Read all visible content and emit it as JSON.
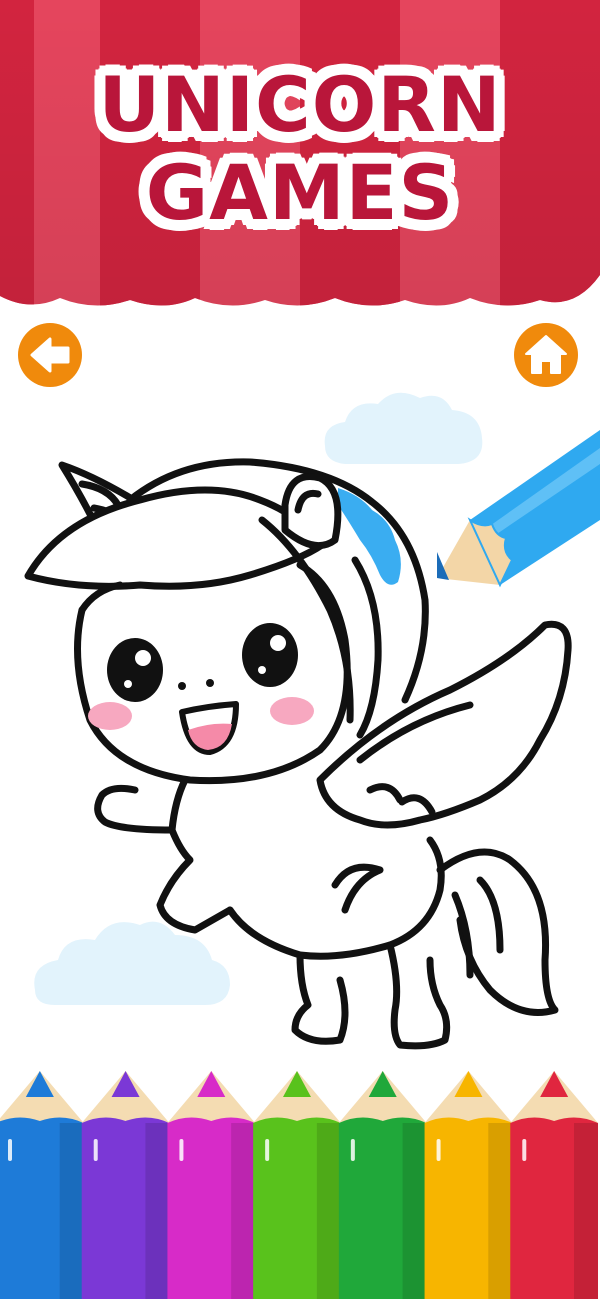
{
  "header": {
    "title_line1": "UNICORN",
    "title_line2": "GAMES"
  },
  "colors": {
    "awning_dark": "#d2243f",
    "awning_light": "#e5455d",
    "title_text": "#b9163a",
    "nav_button": "#f08a0c",
    "brush_blue": "#2fa9f0",
    "cheek_pink": "#f7a8c0",
    "cloud": "#e2f3fc"
  },
  "nav": {
    "back_icon": "arrow-left-icon",
    "home_icon": "home-icon"
  },
  "palette": [
    {
      "name": "blue",
      "color": "#1e7bd8"
    },
    {
      "name": "purple",
      "color": "#7b38d6"
    },
    {
      "name": "magenta",
      "color": "#d72bc8"
    },
    {
      "name": "light-green",
      "color": "#59c21c"
    },
    {
      "name": "green",
      "color": "#20a83a"
    },
    {
      "name": "yellow",
      "color": "#f7b500"
    },
    {
      "name": "red",
      "color": "#e0263f"
    }
  ]
}
